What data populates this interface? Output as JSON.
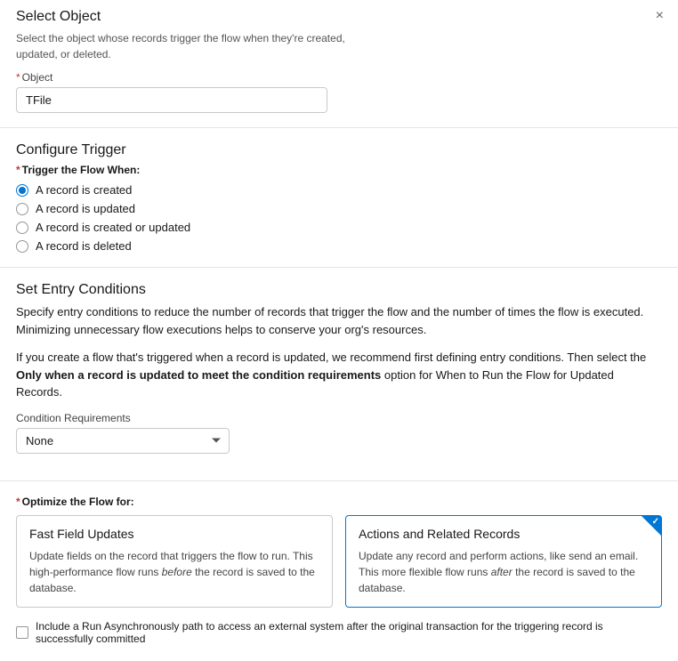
{
  "close_label": "×",
  "selectObject": {
    "title": "Select Object",
    "desc": "Select the object whose records trigger the flow when they're created, updated, or deleted.",
    "fieldLabel": "Object",
    "value": "TFile"
  },
  "configureTrigger": {
    "title": "Configure Trigger",
    "label": "Trigger the Flow When:",
    "options": [
      {
        "label": "A record is created",
        "selected": true
      },
      {
        "label": "A record is updated",
        "selected": false
      },
      {
        "label": "A record is created or updated",
        "selected": false
      },
      {
        "label": "A record is deleted",
        "selected": false
      }
    ]
  },
  "entryConditions": {
    "title": "Set Entry Conditions",
    "desc1": "Specify entry conditions to reduce the number of records that trigger the flow and the number of times the flow is executed. Minimizing unnecessary flow executions helps to conserve your org's resources.",
    "desc2a": "If you create a flow that's triggered when a record is updated, we recommend first defining entry conditions. Then select the ",
    "desc2b": "Only when a record is updated to meet the condition requirements",
    "desc2c": " option for When to Run the Flow for Updated Records.",
    "reqLabel": "Condition Requirements",
    "reqValue": "None"
  },
  "optimize": {
    "label": "Optimize the Flow for:",
    "cards": [
      {
        "title": "Fast Field Updates",
        "desc_a": "Update fields on the record that triggers the flow to run. This high-performance flow runs ",
        "desc_i": "before",
        "desc_b": " the record is saved to the database.",
        "selected": false
      },
      {
        "title": "Actions and Related Records",
        "desc_a": "Update any record and perform actions, like send an email. This more flexible flow runs ",
        "desc_i": "after",
        "desc_b": " the record is saved to the database.",
        "selected": true
      }
    ]
  },
  "async": {
    "label": "Include a Run Asynchronously path to access an external system after the original transaction for the triggering record is successfully committed"
  }
}
